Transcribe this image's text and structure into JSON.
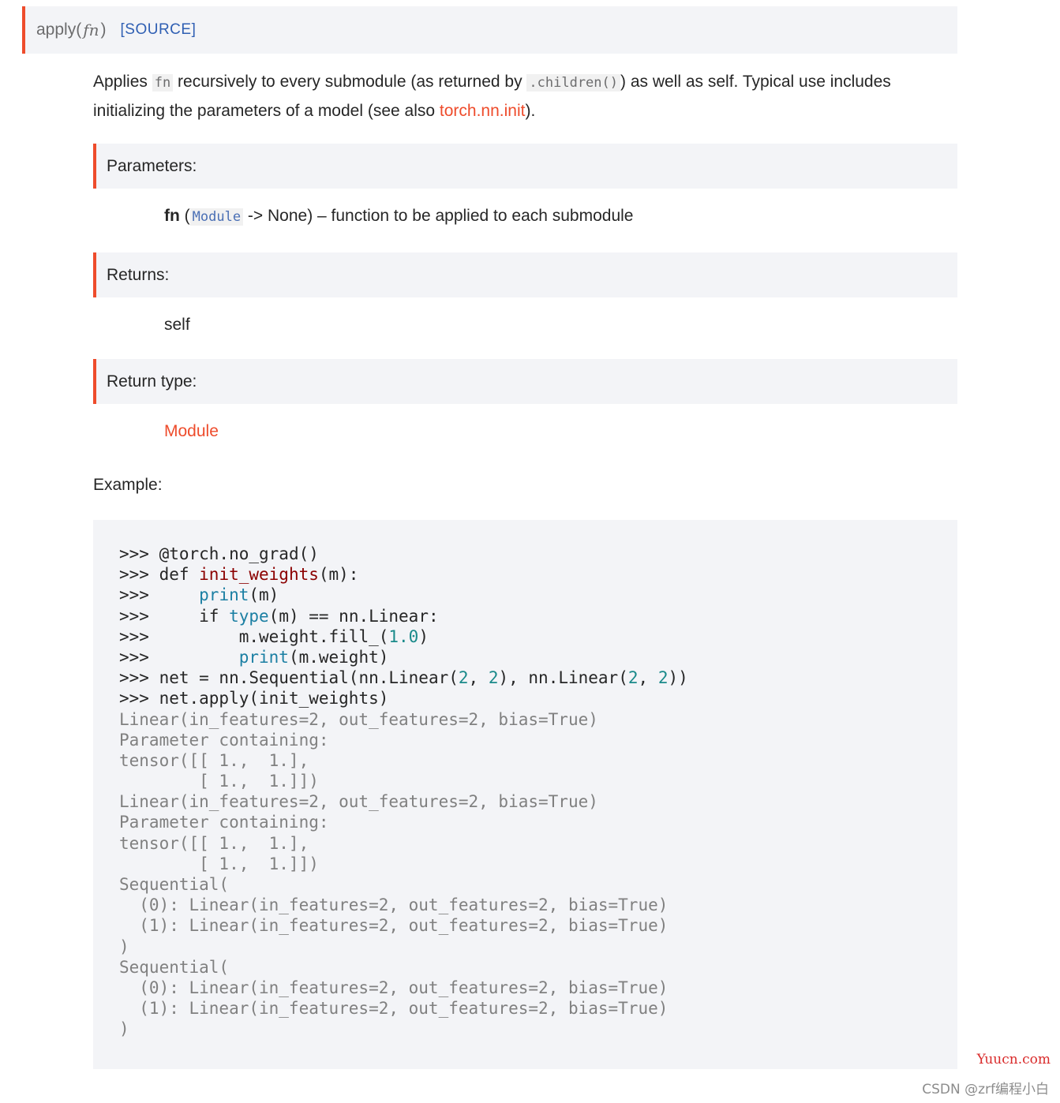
{
  "signature": {
    "name": "apply",
    "open_paren": "(",
    "param": "fn",
    "close_paren": ")",
    "source_label": "[SOURCE]"
  },
  "description": {
    "t1": "Applies ",
    "code1": "fn",
    "t2": " recursively to every submodule (as returned by ",
    "code2": ".children()",
    "t3": ") as well as self. Typical use includes initializing the parameters of a model (see also ",
    "link": "torch.nn.init",
    "t4": ")."
  },
  "fields": {
    "parameters_label": "Parameters:",
    "param_name": "fn",
    "param_open": " (",
    "param_type": "Module",
    "param_rest": " -> None) – function to be applied to each submodule",
    "returns_label": "Returns:",
    "returns_value": "self",
    "return_type_label": "Return type:",
    "return_type_value": "Module"
  },
  "example_label": "Example:",
  "code": {
    "prompt": ">>> ",
    "l1": "@torch.no_grad()",
    "l2_kw": "def ",
    "l2_fn": "init_weights",
    "l2_rest": "(m):",
    "l3_indent": "    ",
    "l3_b": "print",
    "l3_rest": "(m)",
    "l4_indent": "    ",
    "l4_kw": "if ",
    "l4_b": "type",
    "l4_rest": "(m) == nn.Linear:",
    "l5_indent": "        ",
    "l5_a": "m.weight.fill_(",
    "l5_n": "1.0",
    "l5_b": ")",
    "l6_indent": "        ",
    "l6_b": "print",
    "l6_rest": "(m.weight)",
    "l7_a": "net = nn.Sequential(nn.Linear(",
    "l7_n1": "2",
    "l7_s1": ", ",
    "l7_n2": "2",
    "l7_s2": "), nn.Linear(",
    "l7_n3": "2",
    "l7_s3": ", ",
    "l7_n4": "2",
    "l7_s4": "))",
    "l8": "net.apply(init_weights)",
    "output": [
      "Linear(in_features=2, out_features=2, bias=True)",
      "Parameter containing:",
      "tensor([[ 1.,  1.],",
      "        [ 1.,  1.]])",
      "Linear(in_features=2, out_features=2, bias=True)",
      "Parameter containing:",
      "tensor([[ 1.,  1.],",
      "        [ 1.,  1.]])",
      "Sequential(",
      "  (0): Linear(in_features=2, out_features=2, bias=True)",
      "  (1): Linear(in_features=2, out_features=2, bias=True)",
      ")",
      "Sequential(",
      "  (0): Linear(in_features=2, out_features=2, bias=True)",
      "  (1): Linear(in_features=2, out_features=2, bias=True)",
      ")"
    ]
  },
  "watermarks": {
    "site": "Yuucn.com",
    "csdn": "CSDN @zrf编程小白"
  },
  "colors": {
    "accent": "#ee4c2c",
    "link_blue": "#2f5fb3",
    "builtin": "#1b7fa3",
    "number": "#1a8a8a",
    "function_name": "#8b0000",
    "output_gray": "#808080"
  }
}
